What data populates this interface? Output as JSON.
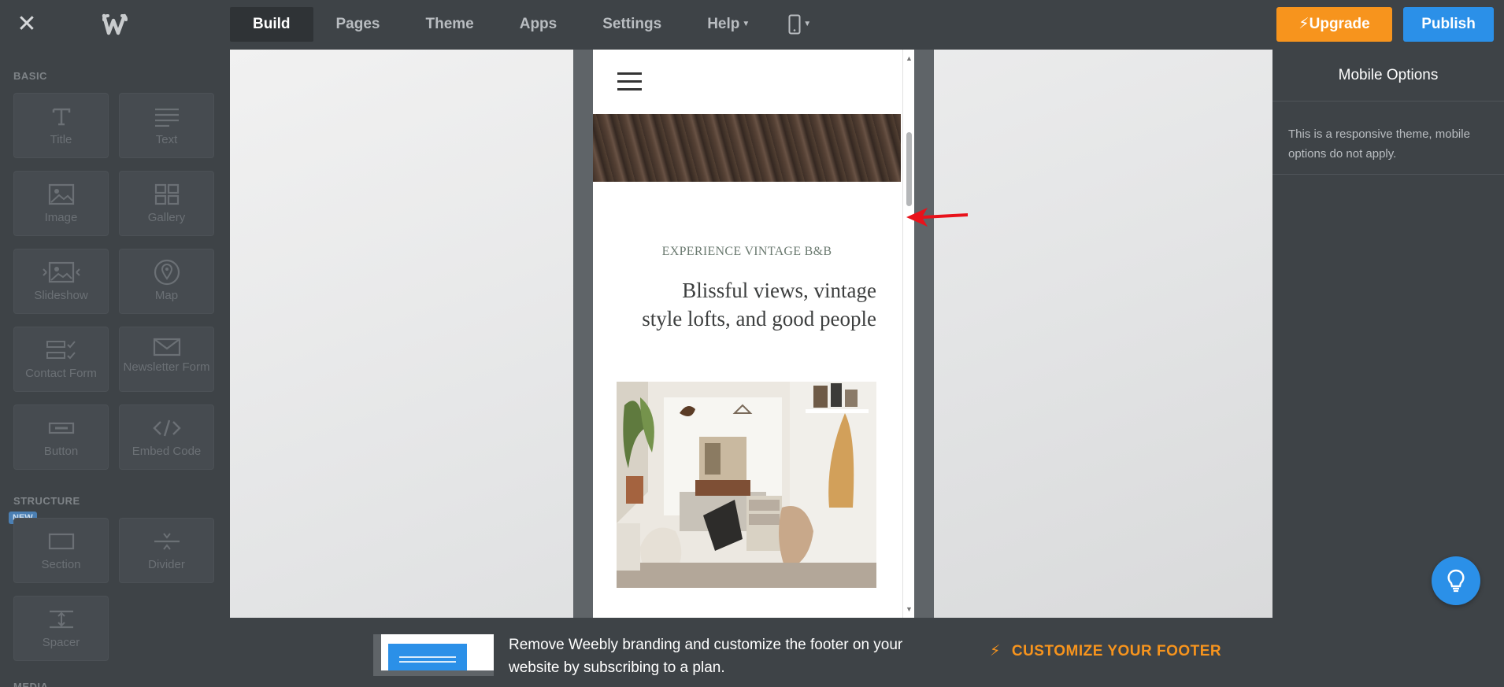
{
  "topbar": {
    "nav": [
      {
        "label": "Build",
        "active": true
      },
      {
        "label": "Pages"
      },
      {
        "label": "Theme"
      },
      {
        "label": "Apps"
      },
      {
        "label": "Settings"
      },
      {
        "label": "Help"
      }
    ],
    "upgrade_label": "Upgrade",
    "publish_label": "Publish"
  },
  "sidebar": {
    "basic_label": "BASIC",
    "structure_label": "STRUCTURE",
    "new_badge": "NEW",
    "media_label": "MEDIA",
    "basic_items": [
      {
        "label": "Title",
        "icon": "title-icon"
      },
      {
        "label": "Text",
        "icon": "text-icon"
      },
      {
        "label": "Image",
        "icon": "image-icon"
      },
      {
        "label": "Gallery",
        "icon": "gallery-icon"
      },
      {
        "label": "Slideshow",
        "icon": "slideshow-icon"
      },
      {
        "label": "Map",
        "icon": "map-pin-icon"
      },
      {
        "label": "Contact Form",
        "icon": "contact-form-icon"
      },
      {
        "label": "Newsletter Form",
        "icon": "envelope-icon"
      },
      {
        "label": "Button",
        "icon": "button-icon"
      },
      {
        "label": "Embed Code",
        "icon": "code-icon"
      }
    ],
    "structure_items": [
      {
        "label": "Section",
        "icon": "section-icon"
      },
      {
        "label": "Divider",
        "icon": "divider-icon"
      },
      {
        "label": "Spacer",
        "icon": "spacer-icon"
      }
    ]
  },
  "preview": {
    "eyebrow": "EXPERIENCE VINTAGE B&B",
    "headline_line1": "Blissful views, vintage",
    "headline_line2": "style lofts, and good people"
  },
  "right_panel": {
    "title": "Mobile Options",
    "message": "This is a responsive theme, mobile options do not apply."
  },
  "footer_banner": {
    "text": "Remove Weebly branding and customize the footer on your website by subscribing to a plan.",
    "cta": "CUSTOMIZE YOUR FOOTER"
  },
  "colors": {
    "chrome": "#3e4347",
    "upgrade": "#f7941d",
    "publish": "#2b90e8",
    "annotation_arrow": "#e8121b"
  }
}
